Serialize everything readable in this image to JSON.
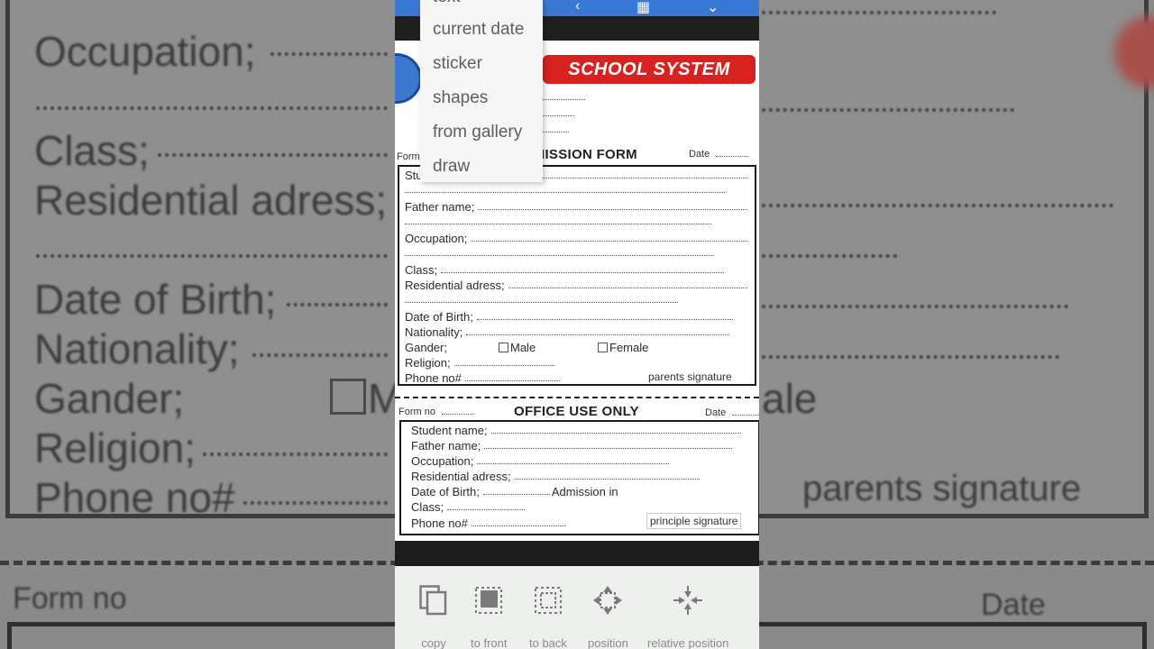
{
  "background": {
    "occupation": "Occupation;",
    "class": "Class;",
    "residential": "Residential adress;",
    "dob": "Date of Birth;",
    "nationality": "Nationality;",
    "gender": "Gander;",
    "male_partial": "M",
    "female_partial": "ale",
    "religion": "Religion;",
    "phone": "Phone no#",
    "parents_signature": "parents signature",
    "form_no": "Form no",
    "date": "Date"
  },
  "popup_menu": {
    "items": [
      "text",
      "current date",
      "sticker",
      "shapes",
      "from gallery",
      "draw"
    ]
  },
  "document": {
    "banner": "SCHOOL SYSTEM",
    "form_no_label": "Form",
    "form_title_visible": "IISSION FORM",
    "date_label": "Date",
    "student_partial": "Stu",
    "fields": {
      "father_name": "Father name;",
      "occupation": "Occupation;",
      "class": "Class;",
      "residential": "Residential adress;",
      "dob": "Date of Birth;",
      "nationality": "Nationality;",
      "gender": "Gander;",
      "male": "Male",
      "female": "Female",
      "religion": "Religion;",
      "phone": "Phone no#"
    },
    "parents_signature": "parents signature",
    "office": {
      "form_no": "Form no",
      "title": "OFFICE USE ONLY",
      "date": "Date",
      "student_name": "Student name;",
      "father_name": "Father name;",
      "occupation": "Occupation;",
      "residential": "Residential adress;",
      "dob": "Date of Birth;",
      "admission": "Admission in",
      "class": "Class;",
      "phone": "Phone no#",
      "principle_signature": "principle signature"
    }
  },
  "toolbar": {
    "items": [
      {
        "label": "copy",
        "icon": "copy-icon"
      },
      {
        "label": "to front",
        "icon": "bring-to-front-icon"
      },
      {
        "label": "to back",
        "icon": "send-to-back-icon"
      },
      {
        "label": "position",
        "icon": "move-arrows-icon"
      },
      {
        "label": "relative position",
        "icon": "relative-position-icon"
      }
    ]
  },
  "colors": {
    "top_bar": "#3a78d6",
    "banner_red": "#d7221f",
    "toolbar_bg": "#eef0ee"
  }
}
